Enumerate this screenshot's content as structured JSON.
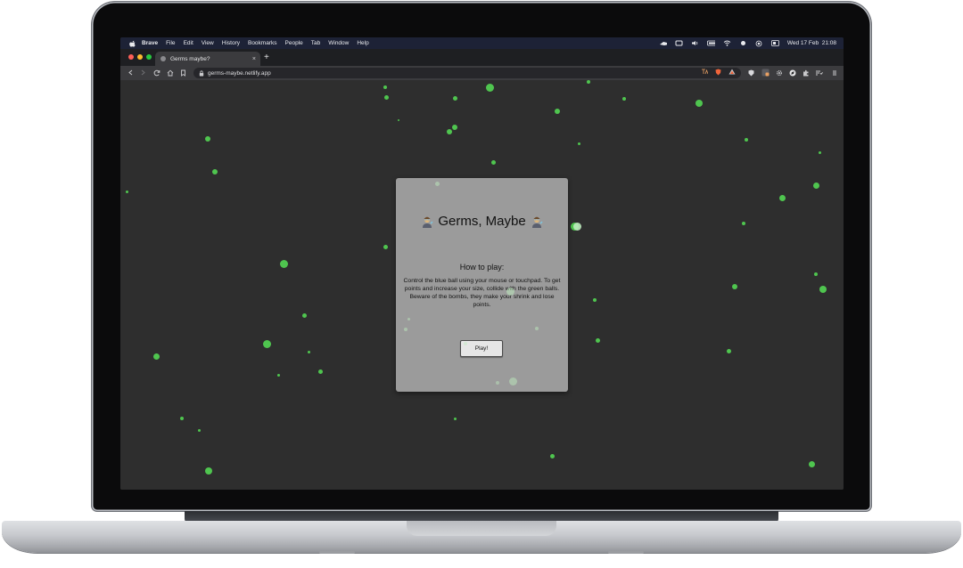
{
  "menubar": {
    "app_name": "Brave",
    "items": [
      "File",
      "Edit",
      "View",
      "History",
      "Bookmarks",
      "People",
      "Tab",
      "Window",
      "Help"
    ],
    "clock": "Wed 17 Feb  21:08"
  },
  "browser": {
    "tab_title": "Germs maybe?",
    "tab_close": "×",
    "new_tab": "+",
    "url": "germs-maybe.netlify.app"
  },
  "game": {
    "title": "Germs, Maybe",
    "instructions_heading": "How to play:",
    "instructions_text": "Control the blue ball using your mouse or touchpad. To get points and increase your size, collide with the green balls. Beware of the bombs, they make your shrink and lose points.",
    "play_label": "Play!",
    "colors": {
      "background": "#2e2e2e",
      "germ": "#4fc54f",
      "modal": "#9b9b9b"
    }
  }
}
